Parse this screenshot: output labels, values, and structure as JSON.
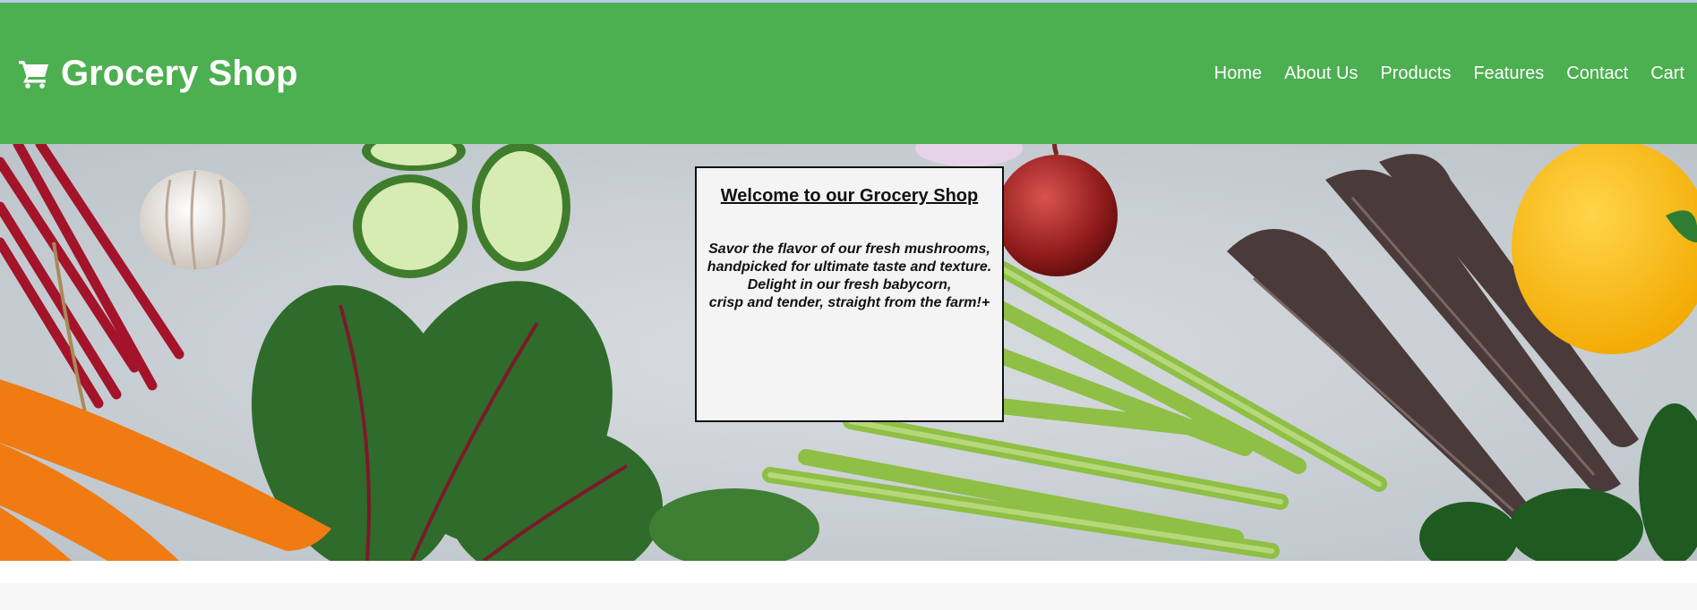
{
  "header": {
    "brand_title": "Grocery Shop",
    "brand_icon": "shopping-cart-icon",
    "background_color": "#4caf50",
    "nav": [
      {
        "label": "Home"
      },
      {
        "label": "About Us"
      },
      {
        "label": "Products"
      },
      {
        "label": "Features"
      },
      {
        "label": "Contact"
      },
      {
        "label": "Cart"
      }
    ]
  },
  "hero": {
    "image": "fresh-vegetables-banner",
    "welcome_box": {
      "title": "Welcome to our Grocery Shop",
      "lines": [
        "Savor the flavor of our fresh mushrooms,",
        "handpicked for ultimate taste and texture.",
        "Delight in our fresh babycorn,",
        "crisp and tender, straight from the farm!+"
      ]
    }
  }
}
